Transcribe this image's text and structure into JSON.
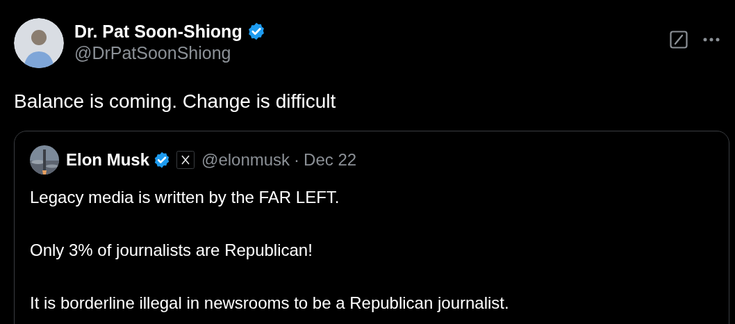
{
  "tweet": {
    "author": {
      "name": "Dr. Pat Soon-Shiong",
      "handle": "@DrPatSoonShiong",
      "verified": true
    },
    "text": "Balance is coming. Change is difficult",
    "quote": {
      "author": {
        "name": "Elon Musk",
        "handle": "@elonmusk",
        "verified": true
      },
      "separator": "·",
      "date": "Dec 22",
      "paragraphs": [
        "Legacy media is written by the FAR LEFT.",
        "Only 3% of journalists are Republican!",
        "It is borderline illegal in newsrooms to be a Republican journalist."
      ]
    }
  }
}
